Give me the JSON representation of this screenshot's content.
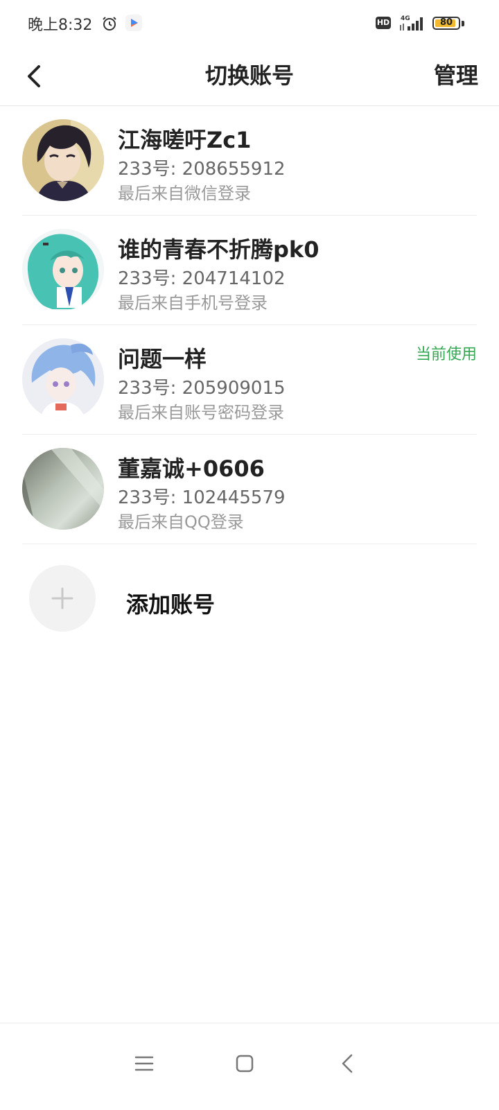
{
  "status_bar": {
    "time": "晚上8:32",
    "network_badge": "HD",
    "network_type": "4G",
    "battery_level": "80",
    "battery_percent": 80,
    "icons": [
      "alarm-icon",
      "video-play-icon",
      "signal-icon",
      "battery-icon"
    ]
  },
  "header": {
    "title": "切换账号",
    "manage_label": "管理",
    "back_icon": "chevron-left-icon"
  },
  "accounts": [
    {
      "name": "江海嗟吁Zc1",
      "id_prefix": "233号: ",
      "id_number": "208655912",
      "login_method": "最后来自微信登录",
      "current": "",
      "avatar": "dark-hair-anime-avatar"
    },
    {
      "name": "谁的青春不折腾pk0",
      "id_prefix": "233号: ",
      "id_number": "204714102",
      "login_method": "最后来自手机号登录",
      "current": "",
      "avatar": "teal-hair-anime-avatar"
    },
    {
      "name": "问题一样",
      "id_prefix": "233号: ",
      "id_number": "205909015",
      "login_method": "最后来自账号密码登录",
      "current": "当前使用",
      "avatar": "blue-hair-anime-avatar"
    },
    {
      "name": "董嘉诚+0606",
      "id_prefix": "233号: ",
      "id_number": "102445579",
      "login_method": "最后来自QQ登录",
      "current": "",
      "avatar": "blurry-photo-avatar"
    }
  ],
  "add_account": {
    "label": "添加账号",
    "icon": "plus-icon"
  },
  "nav_bar": {
    "icons": [
      "menu-icon",
      "home-icon",
      "back-icon"
    ]
  },
  "colors": {
    "accent_green": "#35a853",
    "text_primary": "#222222",
    "text_secondary": "#999999"
  }
}
